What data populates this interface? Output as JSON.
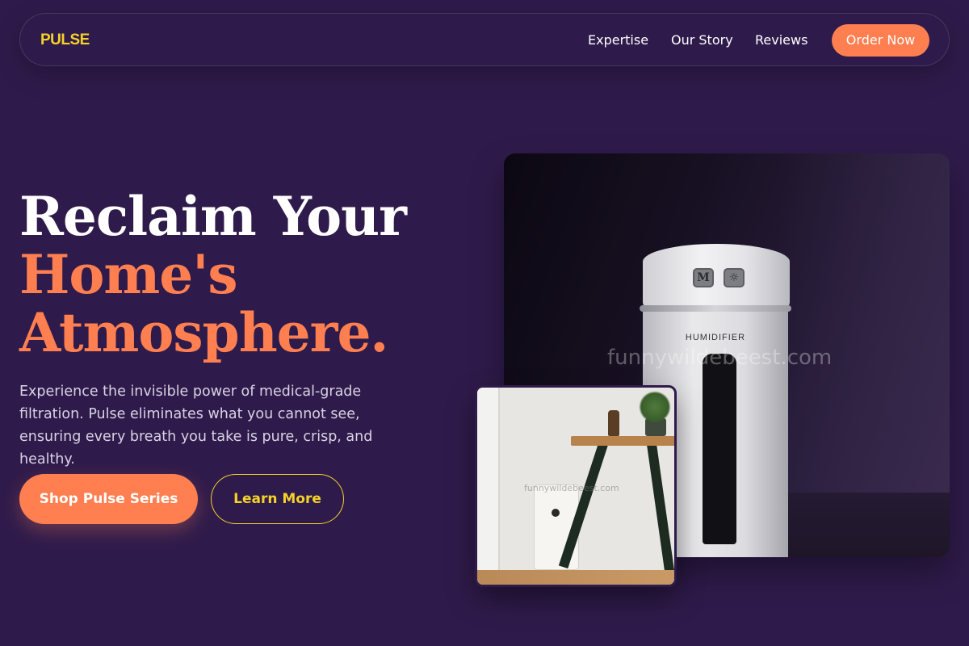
{
  "brand": {
    "logo": "PULSE",
    "accent": "#ff7f50",
    "logo_color": "#f5d229",
    "background": "#2f1b4b"
  },
  "nav": {
    "links": [
      "Expertise",
      "Our Story",
      "Reviews"
    ],
    "cta": "Order Now"
  },
  "hero": {
    "headline_line1": "Reclaim Your",
    "headline_line2": "Home's",
    "headline_line3": "Atmosphere.",
    "description": "Experience the invisible power of medical-grade filtration. Pulse eliminates what you cannot see, ensuring every breath you take is pure, crisp, and healthy.",
    "primary_button": "Shop Pulse Series",
    "secondary_button": "Learn More"
  },
  "images": {
    "main_product_label": "HUMIDIFIER",
    "main_button_1": "M",
    "main_button_2": "☼",
    "watermark_main": "funnywildebeest.com",
    "watermark_secondary": "funnywildebeest.com"
  }
}
